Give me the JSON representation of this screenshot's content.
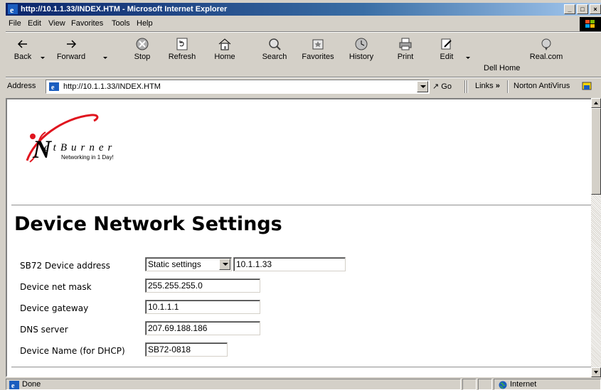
{
  "window": {
    "title": "http://10.1.1.33/INDEX.HTM - Microsoft Internet Explorer",
    "controls": [
      "_",
      "□",
      "×"
    ]
  },
  "menu": [
    "File",
    "Edit",
    "View",
    "Favorites",
    "Tools",
    "Help"
  ],
  "toolbar": {
    "back": "Back",
    "forward": "Forward",
    "stop": "Stop",
    "refresh": "Refresh",
    "home": "Home",
    "search": "Search",
    "favorites": "Favorites",
    "history": "History",
    "print": "Print",
    "edit": "Edit",
    "dell_home": "Dell Home",
    "real_com": "Real.com"
  },
  "address": {
    "label": "Address",
    "url": "http://10.1.1.33/INDEX.HTM",
    "go": "Go",
    "links": "Links",
    "links_chevron": "»",
    "norton": "Norton AntiVirus"
  },
  "page": {
    "logo_word": "etBurner",
    "logo_letter": "N",
    "logo_tagline": "Networking in 1 Day!",
    "title": "Device Network Settings",
    "form": [
      {
        "label": "SB72 Device address",
        "select_value": "Static settings",
        "value": "10.1.1.33"
      },
      {
        "label": "Device net mask",
        "value": "255.255.255.0"
      },
      {
        "label": "Device gateway",
        "value": "10.1.1.1"
      },
      {
        "label": "DNS server",
        "value": "207.69.188.186"
      },
      {
        "label": "Device Name (for DHCP)",
        "value": "SB72-0818"
      }
    ]
  },
  "status": {
    "text": "Done",
    "zone": "Internet"
  },
  "colors": {
    "titlebar": "#0a246a",
    "logo_red": "#e0141e",
    "chrome": "#d4d0c8"
  }
}
